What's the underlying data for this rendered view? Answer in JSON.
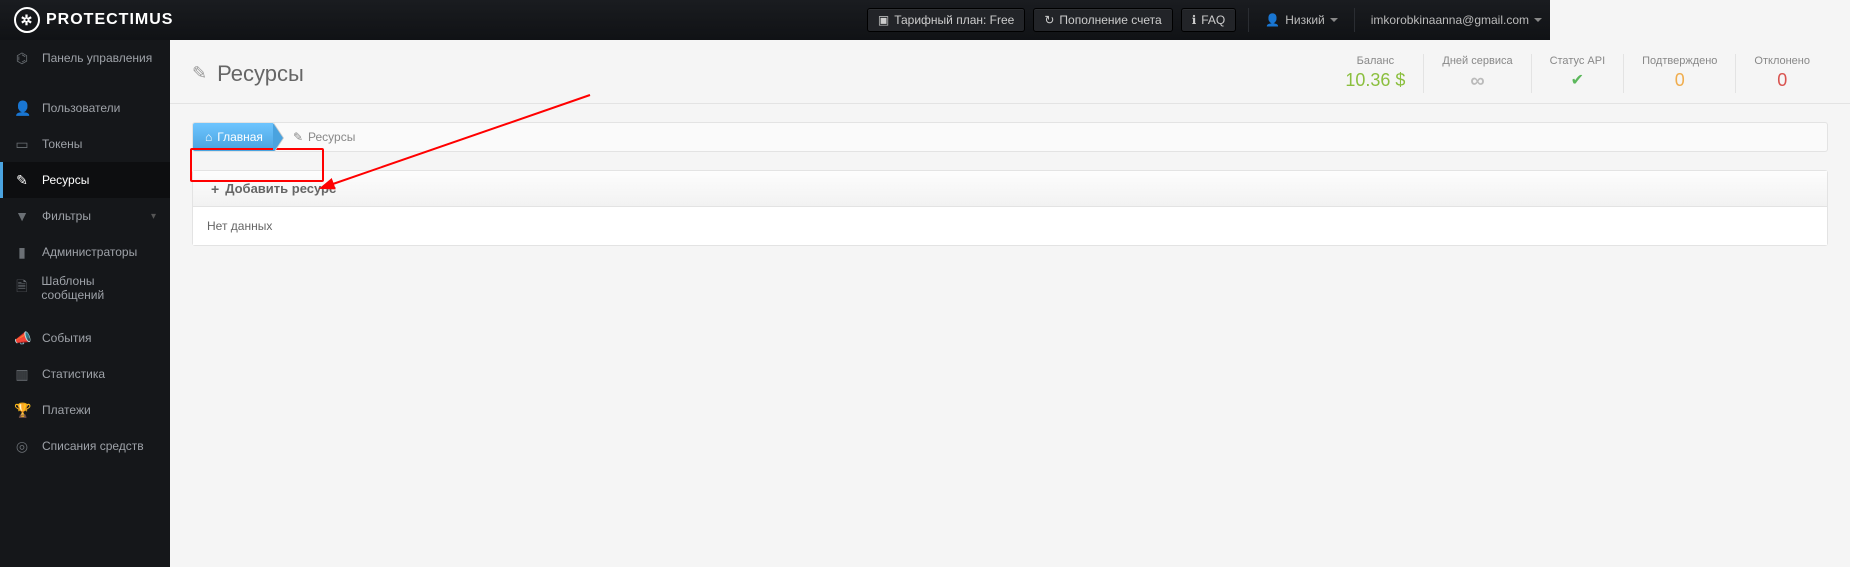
{
  "top": {
    "brand": "PROTECTIMUS",
    "tariff_label": "Тарифный план: Free",
    "recharge_label": "Пополнение счета",
    "faq_label": "FAQ",
    "risk_label": "Низкий",
    "user_email": "imkorobkinaanna@gmail.com"
  },
  "sidebar": {
    "dashboard": "Панель управления",
    "users": "Пользователи",
    "tokens": "Токены",
    "resources": "Ресурсы",
    "filters": "Фильтры",
    "admins": "Администраторы",
    "templates": "Шаблоны сообщений",
    "events": "События",
    "stats": "Статистика",
    "payments": "Платежи",
    "writeoffs": "Списания средств"
  },
  "page": {
    "title": "Ресурсы",
    "breadcrumb_home": "Главная",
    "breadcrumb_current": "Ресурсы",
    "add_button": "Добавить ресурс",
    "empty_text": "Нет данных"
  },
  "stats": {
    "balance_label": "Баланс",
    "balance_value": "10.36 $",
    "days_label": "Дней сервиса",
    "days_value": "∞",
    "api_label": "Статус API",
    "api_value": "✔",
    "confirmed_label": "Подтверждено",
    "confirmed_value": "0",
    "rejected_label": "Отклонено",
    "rejected_value": "0"
  }
}
